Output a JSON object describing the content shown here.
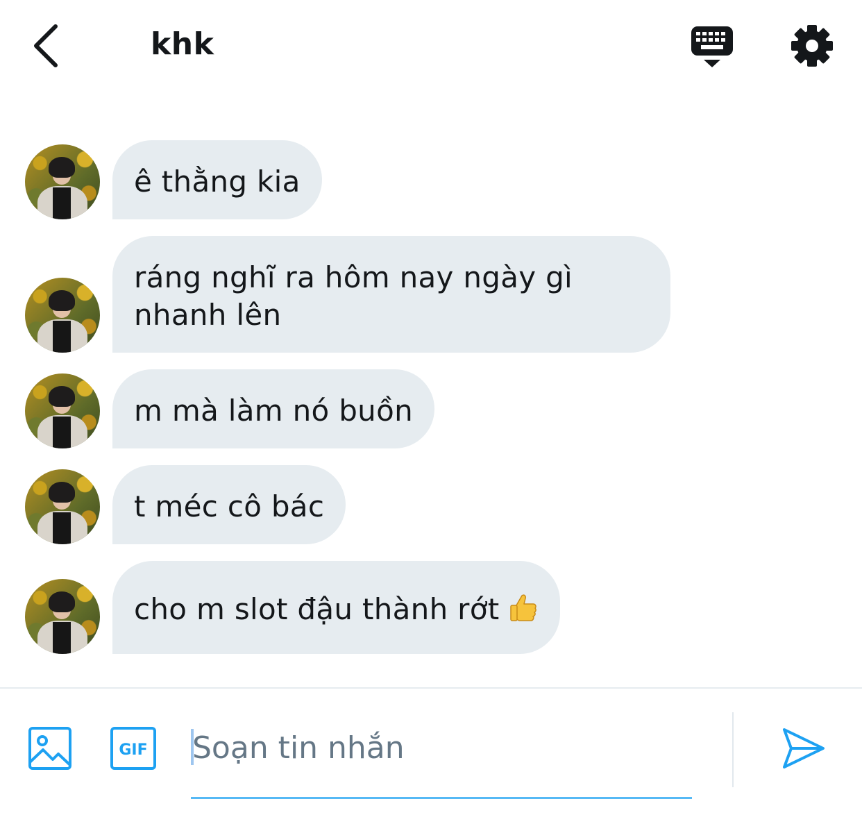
{
  "header": {
    "title": "khk",
    "icons": {
      "back": "chevron-left-icon",
      "keyboard": "keyboard-icon",
      "settings": "gear-icon"
    }
  },
  "messages": [
    {
      "lines": [
        "ê thằng kia"
      ]
    },
    {
      "lines": [
        "ráng nghĩ ra hôm nay ngày gì",
        "nhanh lên"
      ]
    },
    {
      "lines": [
        "m mà làm nó buồn"
      ]
    },
    {
      "lines": [
        "t méc cô bác"
      ]
    },
    {
      "lines": [
        "cho m slot đậu thành rớt"
      ],
      "emoji": "thumbs-up"
    }
  ],
  "composer": {
    "placeholder": "Soạn tin nhắn",
    "value": "",
    "icons": {
      "media": "image-icon",
      "gif": "gif-icon",
      "send": "send-icon"
    },
    "gif_label": "GIF"
  },
  "colors": {
    "accent": "#1da1f2",
    "bubble_bg": "#e6ecf0",
    "text": "#14171a",
    "placeholder": "#657786"
  }
}
